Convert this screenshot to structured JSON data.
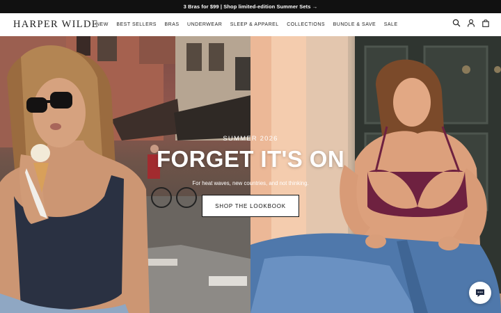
{
  "announcement": {
    "text": "3 Bras for $99 | Shop limited-edition Summer Sets →"
  },
  "header": {
    "logo": "HARPER WILDE",
    "nav": [
      {
        "label": "NEW",
        "name": "nav-new"
      },
      {
        "label": "BEST SELLERS",
        "name": "nav-best-sellers"
      },
      {
        "label": "BRAS",
        "name": "nav-bras"
      },
      {
        "label": "UNDERWEAR",
        "name": "nav-underwear"
      },
      {
        "label": "SLEEP & APPAREL",
        "name": "nav-sleep-apparel"
      },
      {
        "label": "COLLECTIONS",
        "name": "nav-collections"
      },
      {
        "label": "BUNDLE & SAVE",
        "name": "nav-bundle-save"
      },
      {
        "label": "SALE",
        "name": "nav-sale"
      }
    ],
    "icons": [
      "search-icon",
      "account-icon",
      "bag-icon"
    ]
  },
  "hero": {
    "eyebrow": "SUMMER 2026",
    "headline": "FORGET IT'S ON",
    "subtext": "For heat waves, new countries, and not thinking.",
    "cta_label": "SHOP THE LOOKBOOK"
  },
  "colors": {
    "announce_bg": "#111111",
    "text": "#222222",
    "bra_plum": "#6e2140",
    "swimsuit_navy": "#2a3142",
    "denim": "#4f78ab"
  },
  "chat": {
    "icon": "chat-bubble-icon"
  }
}
